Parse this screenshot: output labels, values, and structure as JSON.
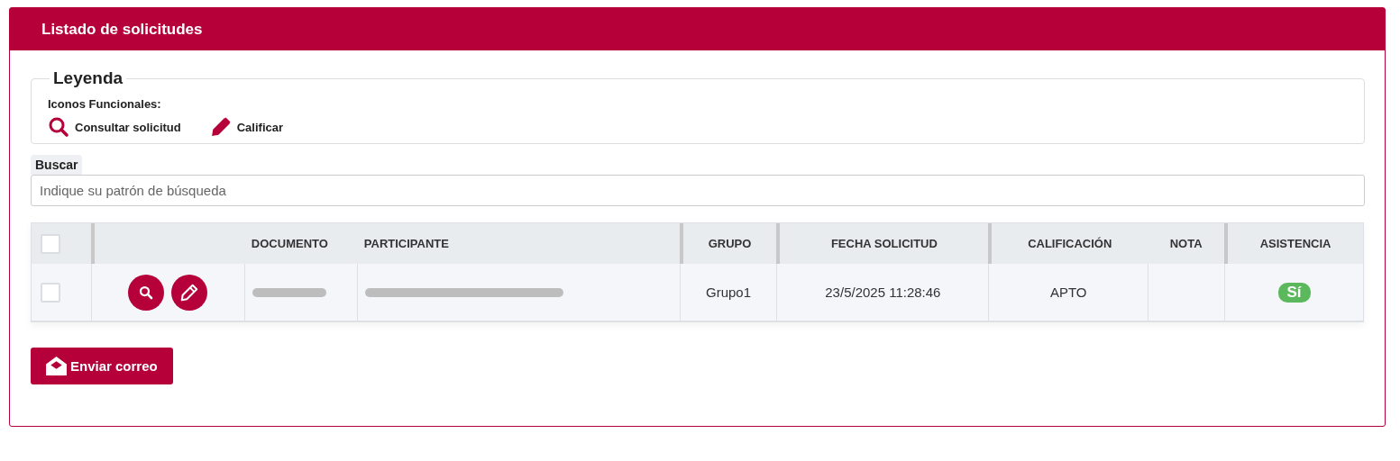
{
  "panel": {
    "title": "Listado de solicitudes"
  },
  "legend": {
    "title": "Leyenda",
    "subtitle": "Iconos Funcionales:",
    "items": [
      {
        "kind": "search",
        "label": "Consultar solicitud"
      },
      {
        "kind": "edit",
        "label": "Calificar"
      }
    ]
  },
  "search": {
    "label": "Buscar",
    "placeholder": "Indique su patrón de búsqueda"
  },
  "table": {
    "select_all": {
      "checked": false
    },
    "columns": [
      {
        "label": "DOCUMENTO"
      },
      {
        "label": "PARTICIPANTE"
      },
      {
        "label": "GRUPO"
      },
      {
        "label": "FECHA SOLICITUD"
      },
      {
        "label": "CALIFICACIÓN"
      },
      {
        "label": "NOTA"
      },
      {
        "label": "ASISTENCIA"
      }
    ],
    "rows": [
      {
        "checked": false,
        "actions": [
          {
            "kind": "search"
          },
          {
            "kind": "edit"
          }
        ],
        "cells": [
          {
            "kind": "redacted"
          },
          {
            "kind": "redacted"
          },
          {
            "kind": "text",
            "text": "Grupo1"
          },
          {
            "kind": "text",
            "text": "23/5/2025 11:28:46"
          },
          {
            "kind": "text",
            "text": "APTO"
          },
          {
            "kind": "empty"
          },
          {
            "kind": "badge",
            "text": "Sí"
          }
        ]
      }
    ]
  },
  "buttons": [
    {
      "kind": "mail",
      "label": "Enviar correo"
    }
  ]
}
